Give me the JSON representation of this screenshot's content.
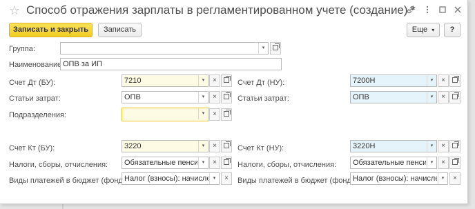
{
  "window": {
    "title": "Способ отражения зарплаты в регламентированном учете (создание) *"
  },
  "title_icons": [
    "link-icon",
    "more-vertical-icon",
    "minimize-icon",
    "close-icon"
  ],
  "toolbar": {
    "save_close_label": "Записать и закрыть",
    "save_label": "Записать",
    "more_label": "Еще",
    "more_arrow": "▾",
    "help_label": "?"
  },
  "form": {
    "group": {
      "label": "Группа:",
      "value": ""
    },
    "name": {
      "label": "Наименование:",
      "value": "ОПВ за ИП"
    },
    "debit_bu": {
      "label": "Счет Дт (БУ):",
      "value": "7210"
    },
    "cost_items_left": {
      "label": "Статьи затрат:",
      "value": "ОПВ"
    },
    "department": {
      "label": "Подразделения:",
      "value": ""
    },
    "credit_bu": {
      "label": "Счет Кт (БУ):",
      "value": "3220"
    },
    "taxes_left": {
      "label": "Налоги, сборы, отчисления:",
      "value": "Обязательные пенсион"
    },
    "payments_left": {
      "label": "Виды платежей в бюджет (фонд...",
      "value": "Налог (взносы): начислено"
    },
    "debit_nu": {
      "label": "Счет Дт (НУ):",
      "value": "7200Н"
    },
    "cost_items_right": {
      "label": "Статьи затрат:",
      "value": "ОПВ"
    },
    "credit_nu": {
      "label": "Счет Кт (НУ):",
      "value": "3220Н"
    },
    "taxes_right": {
      "label": "Налоги, сборы, отчисления:",
      "value": "Обязательные пенсион"
    },
    "payments_right": {
      "label": "Виды платежей в бюджет (фонд...",
      "value": "Налог (взносы): начислено"
    }
  },
  "glyphs": {
    "dropdown": "▾",
    "clear": "×"
  },
  "colors": {
    "primary_button": "#f7d637",
    "field_yellow": "#fdfbe3",
    "field_blue": "#e5f3fb",
    "focus_border": "#f0c21b"
  }
}
